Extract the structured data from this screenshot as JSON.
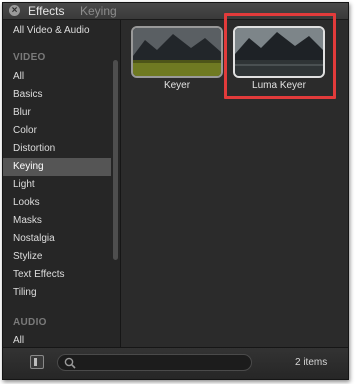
{
  "window": {
    "title": "Effects",
    "subtitle": "Keying"
  },
  "sidebar": {
    "top_item": "All Video & Audio",
    "video_header": "VIDEO",
    "video_items": [
      "All",
      "Basics",
      "Blur",
      "Color",
      "Distortion",
      "Keying",
      "Light",
      "Looks",
      "Masks",
      "Nostalgia",
      "Stylize",
      "Text Effects",
      "Tiling"
    ],
    "selected": "Keying",
    "audio_header": "AUDIO",
    "audio_items": [
      "All"
    ]
  },
  "effects": [
    {
      "label": "Keyer",
      "selected": false
    },
    {
      "label": "Luma Keyer",
      "selected": true
    }
  ],
  "footer": {
    "item_count": "2 items"
  },
  "colors": {
    "highlight": "#e23b3b",
    "selection": "#555555"
  }
}
